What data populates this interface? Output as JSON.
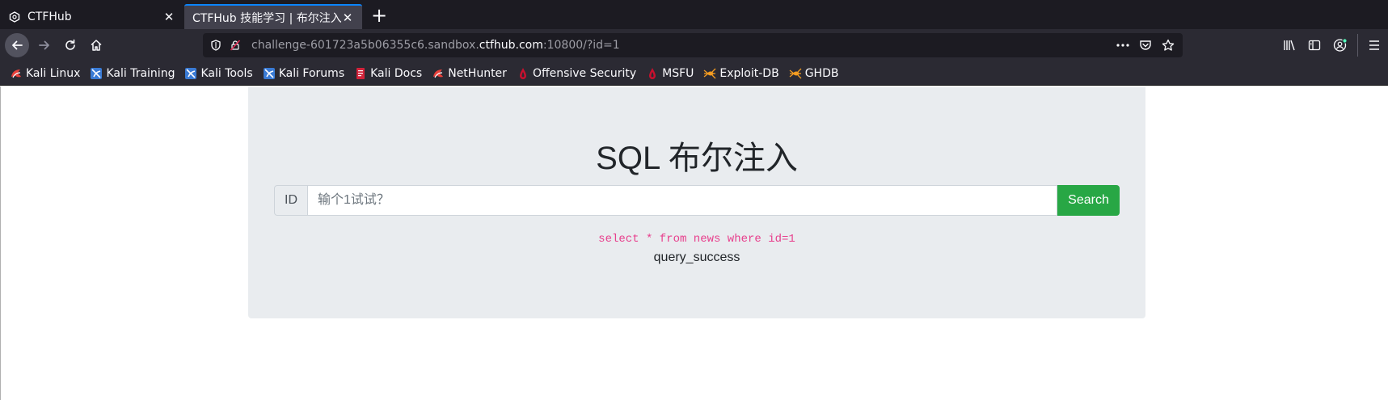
{
  "browser": {
    "tabs": [
      {
        "title": "CTFHub",
        "active": false
      },
      {
        "title": "CTFHub 技能学习 | 布尔注入",
        "active": true
      }
    ],
    "address_bar": {
      "url_prefix": "challenge-601723a5b06355c6.sandbox.",
      "url_domain": "ctfhub.com",
      "url_suffix": ":10800/?id=1"
    },
    "bookmarks": [
      {
        "label": "Kali Linux",
        "icon": "kali-dragon-icon"
      },
      {
        "label": "Kali Training",
        "icon": "kali-training-icon"
      },
      {
        "label": "Kali Tools",
        "icon": "kali-tools-icon"
      },
      {
        "label": "Kali Forums",
        "icon": "kali-forums-icon"
      },
      {
        "label": "Kali Docs",
        "icon": "kali-docs-icon"
      },
      {
        "label": "NetHunter",
        "icon": "nethunter-icon"
      },
      {
        "label": "Offensive Security",
        "icon": "offsec-icon"
      },
      {
        "label": "MSFU",
        "icon": "msfu-icon"
      },
      {
        "label": "Exploit-DB",
        "icon": "exploitdb-icon"
      },
      {
        "label": "GHDB",
        "icon": "ghdb-icon"
      }
    ],
    "colors": {
      "accent": "#0a84ff",
      "tab_bar": "#1c1b22",
      "toolbar": "#2b2a33"
    }
  },
  "page": {
    "title": "SQL 布尔注入",
    "search": {
      "label": "ID",
      "placeholder": "输个1试试？",
      "value": "",
      "button_label": "Search"
    },
    "sql_query": "select * from news where id=1",
    "result": "query_success",
    "colors": {
      "button": "#28a745",
      "sql_text": "#e83e8c",
      "panel": "#e9ecef"
    }
  }
}
